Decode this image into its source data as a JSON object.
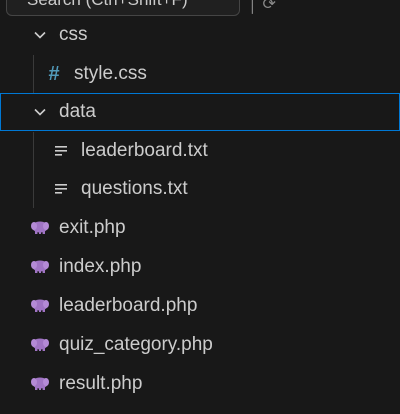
{
  "tooltip": {
    "text": "Search (Ctrl+Shift+F)",
    "tail": "│ ⟳"
  },
  "tree": {
    "css_folder": {
      "label": "css"
    },
    "style_css": {
      "label": "style.css"
    },
    "data_folder": {
      "label": "data"
    },
    "leaderboard_txt": {
      "label": "leaderboard.txt"
    },
    "questions_txt": {
      "label": "questions.txt"
    },
    "exit_php": {
      "label": "exit.php"
    },
    "index_php": {
      "label": "index.php"
    },
    "leaderboard_php": {
      "label": "leaderboard.php"
    },
    "quiz_category_php": {
      "label": "quiz_category.php"
    },
    "result_php": {
      "label": "result.php"
    }
  },
  "colors": {
    "background": "#181818",
    "text": "#cccccc",
    "selection_border": "#0078d4",
    "css_icon": "#519aba",
    "php_icon": "#a074c4"
  },
  "icons": {
    "folder_open": "chevron-down-icon",
    "css_file": "hash-icon",
    "text_file": "lines-icon",
    "php_file": "elephant-icon"
  }
}
